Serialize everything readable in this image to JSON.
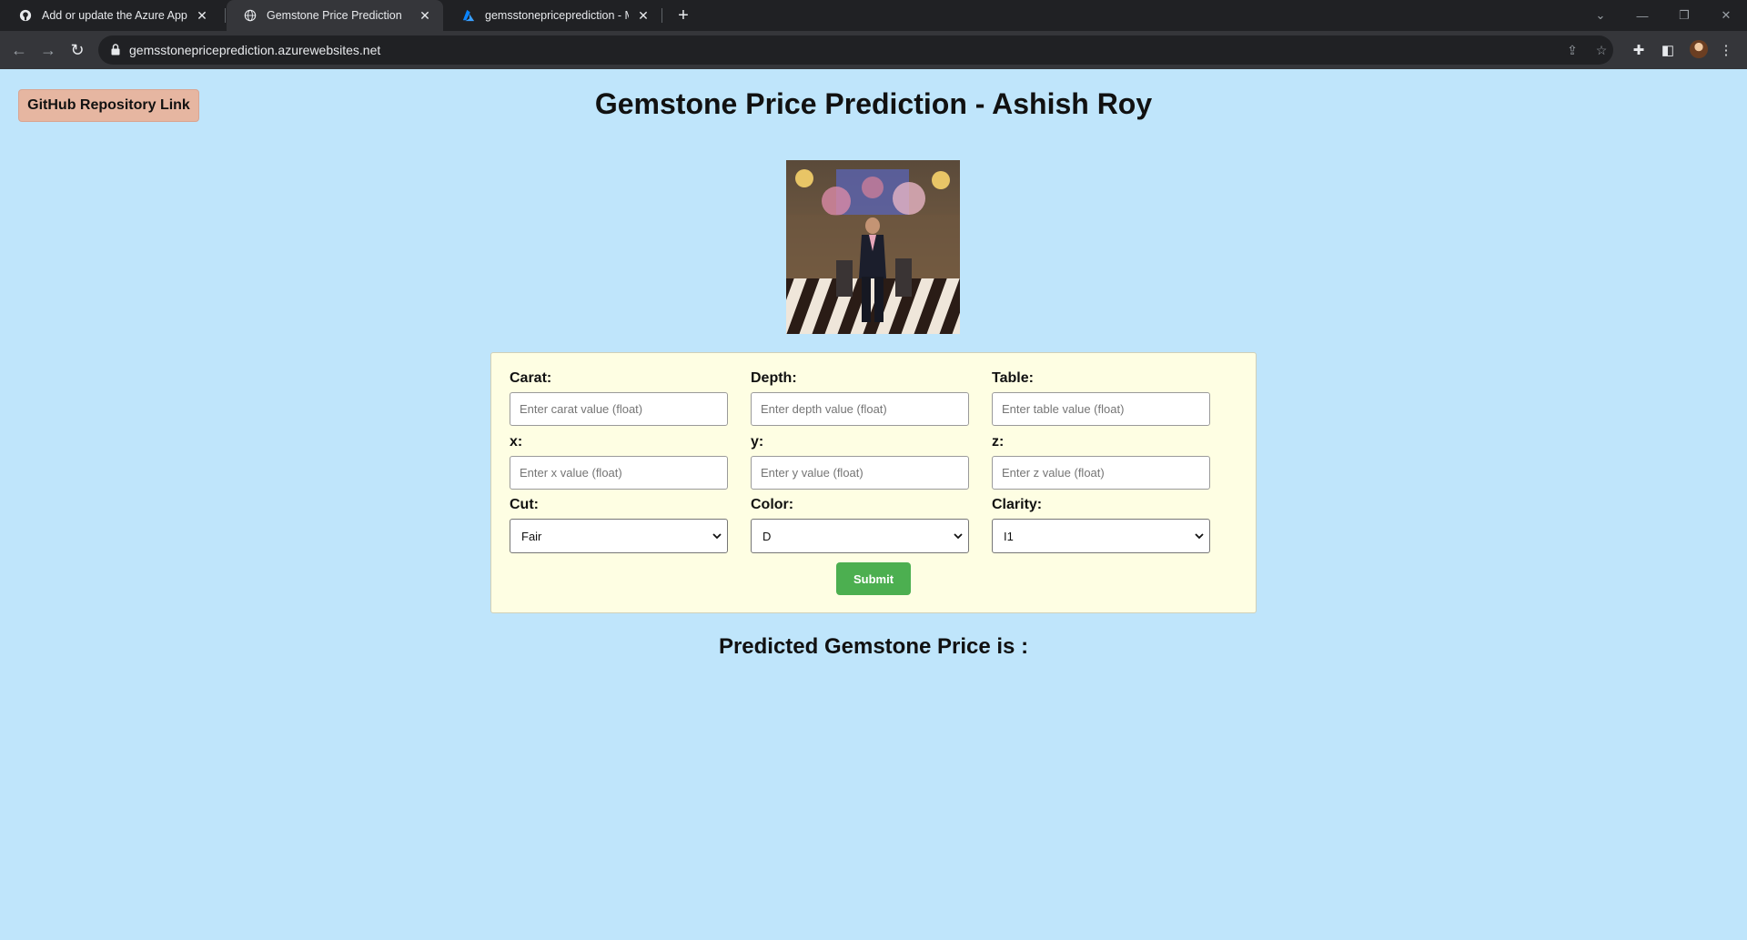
{
  "browser": {
    "tabs": [
      {
        "title": "Add or update the Azure App Se",
        "icon": "github-icon"
      },
      {
        "title": "Gemstone Price Prediction",
        "icon": "globe-icon"
      },
      {
        "title": "gemsstonepriceprediction - Mic",
        "icon": "azure-icon"
      }
    ],
    "url": "gemsstonepriceprediction.azurewebsites.net"
  },
  "page": {
    "github_link": "GitHub Repository Link",
    "title": "Gemstone Price Prediction - Ashish Roy",
    "form": {
      "carat": {
        "label": "Carat:",
        "placeholder": "Enter carat value (float)"
      },
      "depth": {
        "label": "Depth:",
        "placeholder": "Enter depth value (float)"
      },
      "table": {
        "label": "Table:",
        "placeholder": "Enter table value (float)"
      },
      "x": {
        "label": "x:",
        "placeholder": "Enter x value (float)"
      },
      "y": {
        "label": "y:",
        "placeholder": "Enter y value (float)"
      },
      "z": {
        "label": "z:",
        "placeholder": "Enter z value (float)"
      },
      "cut": {
        "label": "Cut:",
        "value": "Fair"
      },
      "color": {
        "label": "Color:",
        "value": "D"
      },
      "clarity": {
        "label": "Clarity:",
        "value": "I1"
      },
      "submit": "Submit"
    },
    "result_label": "Predicted Gemstone Price is :"
  }
}
